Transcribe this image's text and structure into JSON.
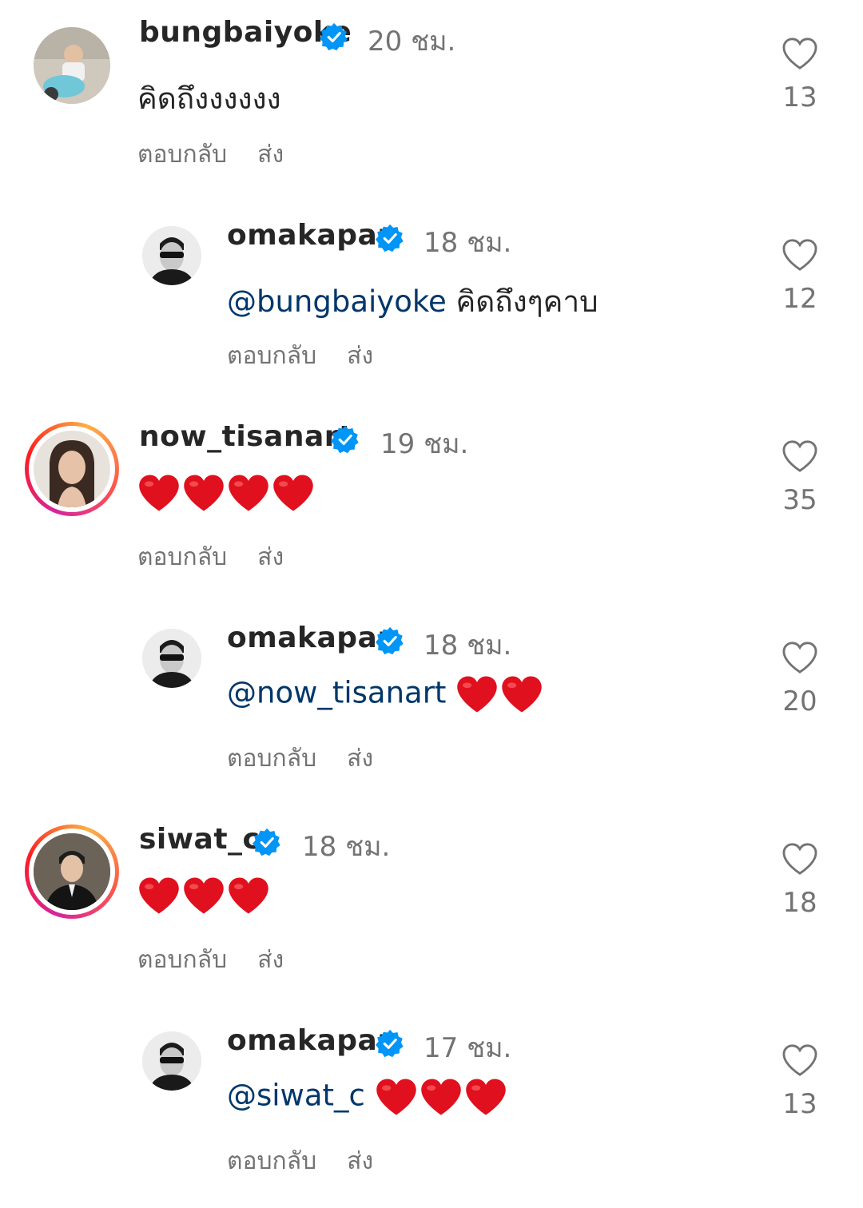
{
  "comments": [
    {
      "username": "bungbaiyoke",
      "time": "20 ชม.",
      "text": "คิดถึงงงงงง",
      "likes": "13",
      "reply_label": "ตอบกลับ",
      "send_label": "ส่ง"
    },
    {
      "username": "omakapan",
      "time": "18 ชม.",
      "mention": "@bungbaiyoke",
      "text": "คิดถึงๆคาบ",
      "likes": "12",
      "reply_label": "ตอบกลับ",
      "send_label": "ส่ง"
    },
    {
      "username": "now_tisanart",
      "time": "19 ชม.",
      "hearts": 4,
      "likes": "35",
      "reply_label": "ตอบกลับ",
      "send_label": "ส่ง"
    },
    {
      "username": "omakapan",
      "time": "18 ชม.",
      "mention": "@now_tisanart",
      "hearts": 2,
      "likes": "20",
      "reply_label": "ตอบกลับ",
      "send_label": "ส่ง"
    },
    {
      "username": "siwat_c",
      "time": "18 ชม.",
      "hearts": 3,
      "likes": "18",
      "reply_label": "ตอบกลับ",
      "send_label": "ส่ง"
    },
    {
      "username": "omakapan",
      "time": "17 ชม.",
      "mention": "@siwat_c",
      "hearts": 3,
      "likes": "13",
      "reply_label": "ตอบกลับ",
      "send_label": "ส่ง"
    }
  ],
  "colors": {
    "verified": "#0095f6",
    "mention": "#00376b",
    "heart_emoji": "#e0101e",
    "muted": "#737373"
  },
  "icons": {
    "verified": "verified-badge-icon",
    "like": "heart-outline-icon",
    "emoji": "red-heart-emoji"
  }
}
